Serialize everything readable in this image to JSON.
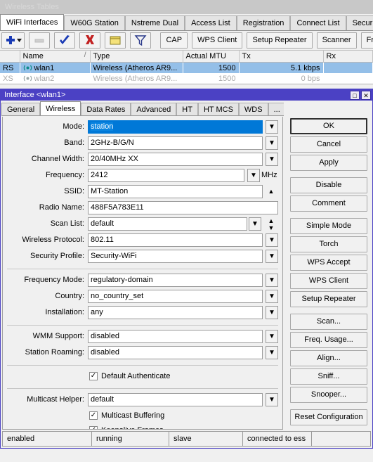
{
  "window": {
    "title": "Wireless Tables"
  },
  "main_tabs": [
    {
      "label": "WiFi Interfaces",
      "active": true
    },
    {
      "label": "W60G Station",
      "active": false
    },
    {
      "label": "Nstreme Dual",
      "active": false
    },
    {
      "label": "Access List",
      "active": false
    },
    {
      "label": "Registration",
      "active": false
    },
    {
      "label": "Connect List",
      "active": false
    },
    {
      "label": "Security Profil",
      "active": false
    }
  ],
  "toolbar": {
    "icon_buttons": [
      {
        "name": "add-button",
        "icon": "plus-icon"
      },
      {
        "name": "remove-button",
        "icon": "minus-icon"
      },
      {
        "name": "enable-button",
        "icon": "check-icon"
      },
      {
        "name": "disable-button",
        "icon": "x-icon"
      },
      {
        "name": "comment-button",
        "icon": "folder-icon"
      },
      {
        "name": "filter-button",
        "icon": "funnel-icon"
      }
    ],
    "text_buttons": [
      "CAP",
      "WPS Client",
      "Setup Repeater",
      "Scanner",
      "Freq. Usage"
    ]
  },
  "table": {
    "columns": [
      "",
      "Name",
      "Type",
      "Actual MTU",
      "Tx",
      "Rx"
    ],
    "sort_indicator": "/",
    "rows": [
      {
        "flags": "RS",
        "name": "wlan1",
        "type": "Wireless (Atheros AR9...",
        "mtu": "1500",
        "tx": "5.1 kbps",
        "rx": "",
        "selected": true
      },
      {
        "flags": "XS",
        "name": "wlan2",
        "type": "Wireless (Atheros AR9...",
        "mtu": "1500",
        "tx": "0 bps",
        "rx": "",
        "selected": false
      }
    ]
  },
  "dialog": {
    "title": "Interface <wlan1>",
    "controls": {
      "restore": "□",
      "close": "✕"
    },
    "tabs": [
      {
        "label": "General",
        "active": false
      },
      {
        "label": "Wireless",
        "active": true
      },
      {
        "label": "Data Rates",
        "active": false
      },
      {
        "label": "Advanced",
        "active": false
      },
      {
        "label": "HT",
        "active": false
      },
      {
        "label": "HT MCS",
        "active": false
      },
      {
        "label": "WDS",
        "active": false
      },
      {
        "label": "...",
        "active": false
      }
    ],
    "fields": {
      "mode": {
        "label": "Mode:",
        "value": "station",
        "selected": true
      },
      "band": {
        "label": "Band:",
        "value": "2GHz-B/G/N"
      },
      "channel_width": {
        "label": "Channel Width:",
        "value": "20/40MHz XX"
      },
      "frequency": {
        "label": "Frequency:",
        "value": "2412",
        "unit": "MHz"
      },
      "ssid": {
        "label": "SSID:",
        "value": "MT-Station"
      },
      "radio_name": {
        "label": "Radio Name:",
        "value": "488F5A783E11"
      },
      "scan_list": {
        "label": "Scan List:",
        "value": "default"
      },
      "wireless_protocol": {
        "label": "Wireless Protocol:",
        "value": "802.11"
      },
      "security_profile": {
        "label": "Security Profile:",
        "value": "Security-WiFi"
      },
      "frequency_mode": {
        "label": "Frequency Mode:",
        "value": "regulatory-domain"
      },
      "country": {
        "label": "Country:",
        "value": "no_country_set"
      },
      "installation": {
        "label": "Installation:",
        "value": "any"
      },
      "wmm_support": {
        "label": "WMM Support:",
        "value": "disabled"
      },
      "station_roaming": {
        "label": "Station Roaming:",
        "value": "disabled"
      },
      "multicast_helper": {
        "label": "Multicast Helper:",
        "value": "default"
      }
    },
    "checkboxes": {
      "default_authenticate": {
        "label": "Default Authenticate",
        "checked": true,
        "mark": "✓"
      },
      "multicast_buffering": {
        "label": "Multicast Buffering",
        "checked": true,
        "mark": "✓"
      },
      "keepalive_frames": {
        "label": "Keepalive Frames",
        "checked": true,
        "mark": "✓"
      }
    },
    "buttons": [
      {
        "label": "OK",
        "default": true,
        "gap": false
      },
      {
        "label": "Cancel",
        "default": false,
        "gap": false
      },
      {
        "label": "Apply",
        "default": false,
        "gap": false
      },
      {
        "label": "Disable",
        "default": false,
        "gap": true
      },
      {
        "label": "Comment",
        "default": false,
        "gap": false
      },
      {
        "label": "Simple Mode",
        "default": false,
        "gap": true
      },
      {
        "label": "Torch",
        "default": false,
        "gap": false
      },
      {
        "label": "WPS Accept",
        "default": false,
        "gap": false
      },
      {
        "label": "WPS Client",
        "default": false,
        "gap": false
      },
      {
        "label": "Setup Repeater",
        "default": false,
        "gap": false
      },
      {
        "label": "Scan...",
        "default": false,
        "gap": true
      },
      {
        "label": "Freq. Usage...",
        "default": false,
        "gap": false
      },
      {
        "label": "Align...",
        "default": false,
        "gap": false
      },
      {
        "label": "Sniff...",
        "default": false,
        "gap": false
      },
      {
        "label": "Snooper...",
        "default": false,
        "gap": false
      },
      {
        "label": "Reset Configuration",
        "default": false,
        "gap": true
      }
    ],
    "status": [
      "enabled",
      "running",
      "slave",
      "connected to ess",
      ""
    ]
  },
  "colors": {
    "dialog_titlebar": "#4b41c4",
    "selection_blue": "#0078d7",
    "row_selection": "#94bfe8",
    "window_bg": "#f0f0f0"
  }
}
